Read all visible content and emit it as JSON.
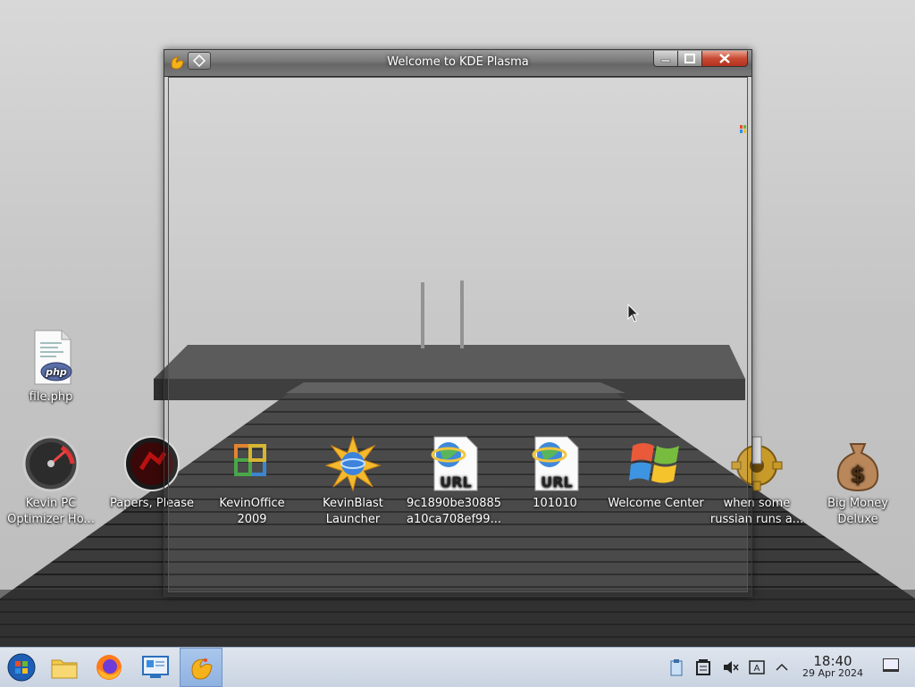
{
  "window": {
    "title": "Welcome to KDE Plasma"
  },
  "desktop_icons": [
    {
      "id": "file-php",
      "icon": "php-file-icon",
      "label": "file.php"
    },
    {
      "id": "kevin-pc",
      "icon": "speedometer-icon",
      "label": "Kevin PC Optimizer Ho..."
    },
    {
      "id": "papers",
      "icon": "papers-please-icon",
      "label": "Papers, Please"
    },
    {
      "id": "kevinoffice",
      "icon": "office-icon",
      "label": "KevinOffice 2009"
    },
    {
      "id": "kevinblast",
      "icon": "kevinblast-icon",
      "label": "KevinBlast Launcher"
    },
    {
      "id": "url1",
      "icon": "url-shortcut-icon",
      "label": "9c1890be30885 a10ca708ef99..."
    },
    {
      "id": "url2",
      "icon": "url-shortcut-icon",
      "label": "101010"
    },
    {
      "id": "welcome",
      "icon": "windows-logo-icon",
      "label": "Welcome Center"
    },
    {
      "id": "russian",
      "icon": "gear-icon",
      "label": "when some russian runs a..."
    },
    {
      "id": "bigmoney",
      "icon": "money-bag-icon",
      "label": "Big Money Deluxe"
    }
  ],
  "taskbar": {
    "items": [
      {
        "icon": "start-orb-icon"
      },
      {
        "icon": "file-manager-icon"
      },
      {
        "icon": "firefox-icon"
      },
      {
        "icon": "system-settings-icon"
      },
      {
        "icon": "kde-welcome-icon",
        "active": true
      }
    ],
    "tray": [
      "clipboard-icon",
      "notes-icon",
      "muted-speaker-icon",
      "keyboard-layout-icon",
      "chevron-up-icon"
    ],
    "clock": {
      "time": "18:40",
      "date": "29 Apr 2024"
    }
  },
  "colors": {
    "taskbar_bg": "#cfd8e5",
    "close_button": "#c84a33",
    "active_task": "#8fb2e0"
  }
}
